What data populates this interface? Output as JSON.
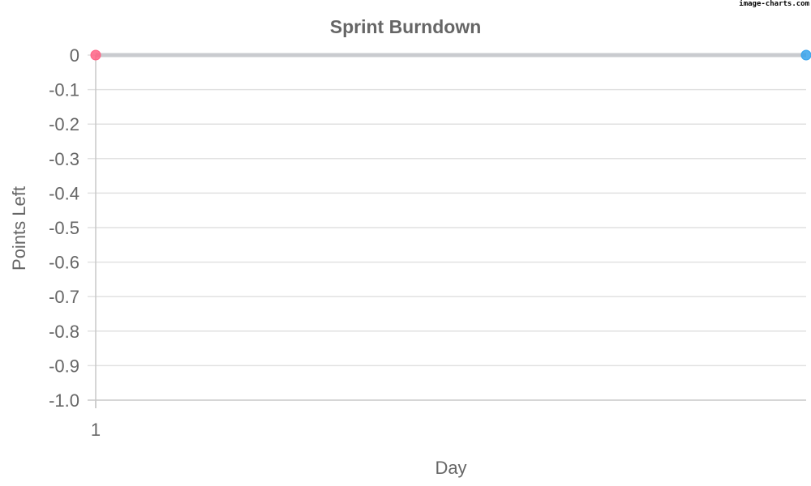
{
  "watermark": "image-charts.com",
  "chart_data": {
    "type": "line",
    "title": "Sprint Burndown",
    "xlabel": "Day",
    "ylabel": "Points Left",
    "categories": [
      "1"
    ],
    "x_range": [
      1,
      2
    ],
    "ylim": [
      -1.0,
      0
    ],
    "y_ticks": [
      "0",
      "-0.1",
      "-0.2",
      "-0.3",
      "-0.4",
      "-0.5",
      "-0.6",
      "-0.7",
      "-0.8",
      "-0.9",
      "-1.0"
    ],
    "grid": true,
    "legend": "none",
    "series": [
      {
        "values": [
          0,
          0
        ],
        "color": "#c9cbcf",
        "start_marker_color": "#ff6384",
        "end_marker_color": "#36a2eb"
      }
    ]
  }
}
